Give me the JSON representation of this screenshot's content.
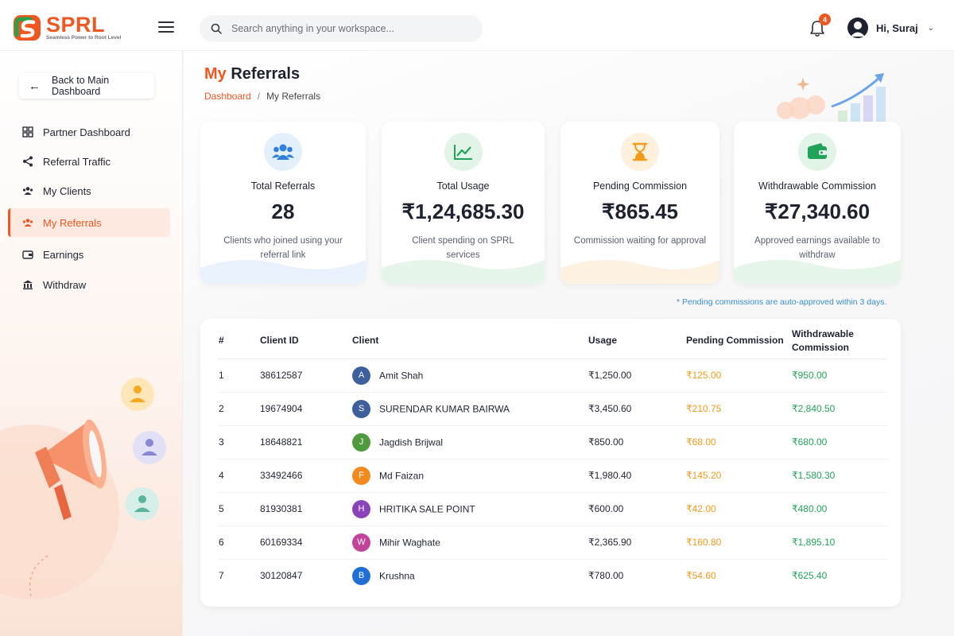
{
  "app": {
    "brand": "SPRL",
    "tagline": "Seamless Power to Root Level"
  },
  "header": {
    "search_placeholder": "Search anything in your workspace...",
    "notification_count": "4",
    "greeting": "Hi, Suraj"
  },
  "sidebar": {
    "back_label": "Back to Main Dashboard",
    "items": [
      {
        "label": "Partner Dashboard",
        "icon": "grid-icon"
      },
      {
        "label": "Referral Traffic",
        "icon": "share-icon"
      },
      {
        "label": "My Clients",
        "icon": "users-icon"
      },
      {
        "label": "My Referrals",
        "icon": "referrals-icon",
        "active": true
      },
      {
        "label": "Earnings",
        "icon": "wallet-icon"
      },
      {
        "label": "Withdraw",
        "icon": "withdraw-icon"
      }
    ]
  },
  "page": {
    "title_highlight": "My",
    "title_rest": "Referrals",
    "breadcrumb_root": "Dashboard",
    "breadcrumb_sep": "/",
    "breadcrumb_current": "My Referrals"
  },
  "stats": [
    {
      "title": "Total Referrals",
      "value": "28",
      "desc": "Clients who joined using your referral link",
      "icon": "users-icon",
      "color": "#2f7fdc"
    },
    {
      "title": "Total Usage",
      "value": "₹1,24,685.30",
      "desc": "Client spending on SPRL services",
      "icon": "trend-icon",
      "color": "#22a35a"
    },
    {
      "title": "Pending Commission",
      "value": "₹865.45",
      "desc": "Commission waiting for approval",
      "icon": "hourglass-icon",
      "color": "#f29b1a"
    },
    {
      "title": "Withdrawable Commission",
      "value": "₹27,340.60",
      "desc": "Approved earnings available to withdraw",
      "icon": "wallet-icon",
      "color": "#22a35a"
    }
  ],
  "note": "* Pending commissions are auto-approved within 3 days.",
  "table": {
    "headers": [
      "#",
      "Client ID",
      "Client",
      "Usage",
      "Pending Commission",
      "Withdrawable Commission"
    ],
    "rows": [
      {
        "idx": "1",
        "client_id": "38612587",
        "initial": "A",
        "avatar_color": "#3d5f9c",
        "client": "Amit Shah",
        "usage": "₹1,250.00",
        "pending": "₹125.00",
        "withdrawable": "₹950.00"
      },
      {
        "idx": "2",
        "client_id": "19674904",
        "initial": "S",
        "avatar_color": "#3d5f9c",
        "client": "SURENDAR KUMAR BAIRWA",
        "usage": "₹3,450.60",
        "pending": "₹210.75",
        "withdrawable": "₹2,840.50"
      },
      {
        "idx": "3",
        "client_id": "18648821",
        "initial": "J",
        "avatar_color": "#4f9a3c",
        "client": "Jagdish Brijwal",
        "usage": "₹850.00",
        "pending": "₹68.00",
        "withdrawable": "₹680.00"
      },
      {
        "idx": "4",
        "client_id": "33492466",
        "initial": "F",
        "avatar_color": "#f38a1f",
        "client": "Md Faizan",
        "usage": "₹1,980.40",
        "pending": "₹145.20",
        "withdrawable": "₹1,580.30"
      },
      {
        "idx": "5",
        "client_id": "81930381",
        "initial": "H",
        "avatar_color": "#8b44b8",
        "client": "HRITIKA SALE POINT",
        "usage": "₹600.00",
        "pending": "₹42.00",
        "withdrawable": "₹480.00"
      },
      {
        "idx": "6",
        "client_id": "60169334",
        "initial": "W",
        "avatar_color": "#c2449a",
        "client": "Mihir Waghate",
        "usage": "₹2,365.90",
        "pending": "₹160.80",
        "withdrawable": "₹1,895.10"
      },
      {
        "idx": "7",
        "client_id": "30120847",
        "initial": "B",
        "avatar_color": "#1f6fd6",
        "client": "Krushna",
        "usage": "₹780.00",
        "pending": "₹54.60",
        "withdrawable": "₹625.40"
      }
    ]
  },
  "colors": {
    "accent": "#f0561f",
    "pending": "#f29b1a",
    "withdrawable": "#22a35a"
  }
}
